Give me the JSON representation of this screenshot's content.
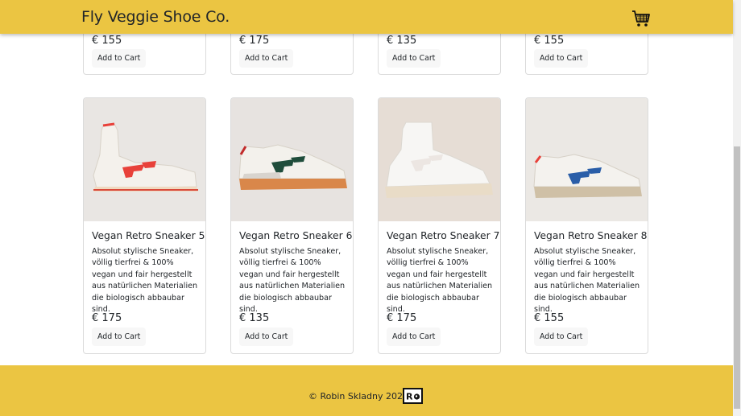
{
  "navbar": {
    "brand": "Fly Veggie Shoe Co.",
    "cart_icon": "shopping-cart-icon"
  },
  "products_top": [
    {
      "price": "€ 155",
      "button": "Add to Cart"
    },
    {
      "price": "€ 175",
      "button": "Add to Cart"
    },
    {
      "price": "€ 135",
      "button": "Add to Cart"
    },
    {
      "price": "€ 155",
      "button": "Add to Cart"
    }
  ],
  "products": [
    {
      "title": "Vegan Retro Sneaker 5",
      "description": "Absolut stylische Sneaker, völlig tierfrei & 100% vegan und fair hergestellt aus natürlichen Materialien die biologisch abbaubar sind.",
      "price": "€ 175",
      "button": "Add to Cart",
      "accent": "#e8413a"
    },
    {
      "title": "Vegan Retro Sneaker 6",
      "description": "Absolut stylische Sneaker, völlig tierfrei & 100% vegan und fair hergestellt aus natürlichen Materialien die biologisch abbaubar sind.",
      "price": "€ 135",
      "button": "Add to Cart",
      "accent": "#1f4d3b"
    },
    {
      "title": "Vegan Retro Sneaker 7",
      "description": "Absolut stylische Sneaker, völlig tierfrei & 100% vegan und fair hergestellt aus natürlichen Materialien die biologisch abbaubar sind.",
      "price": "€ 175",
      "button": "Add to Cart",
      "accent": "#ece6e2"
    },
    {
      "title": "Vegan Retro Sneaker 8",
      "description": "Absolut stylische Sneaker, völlig tierfrei & 100% vegan und fair hergestellt aus natürlichen Materialien die biologisch abbaubar sind.",
      "price": "€ 155",
      "button": "Add to Cart",
      "accent": "#2a5ea8"
    }
  ],
  "footer": {
    "copyright": "© Robin Skladny 2022",
    "logo_text": "R"
  },
  "colors": {
    "brand_yellow": "#ebc542"
  }
}
